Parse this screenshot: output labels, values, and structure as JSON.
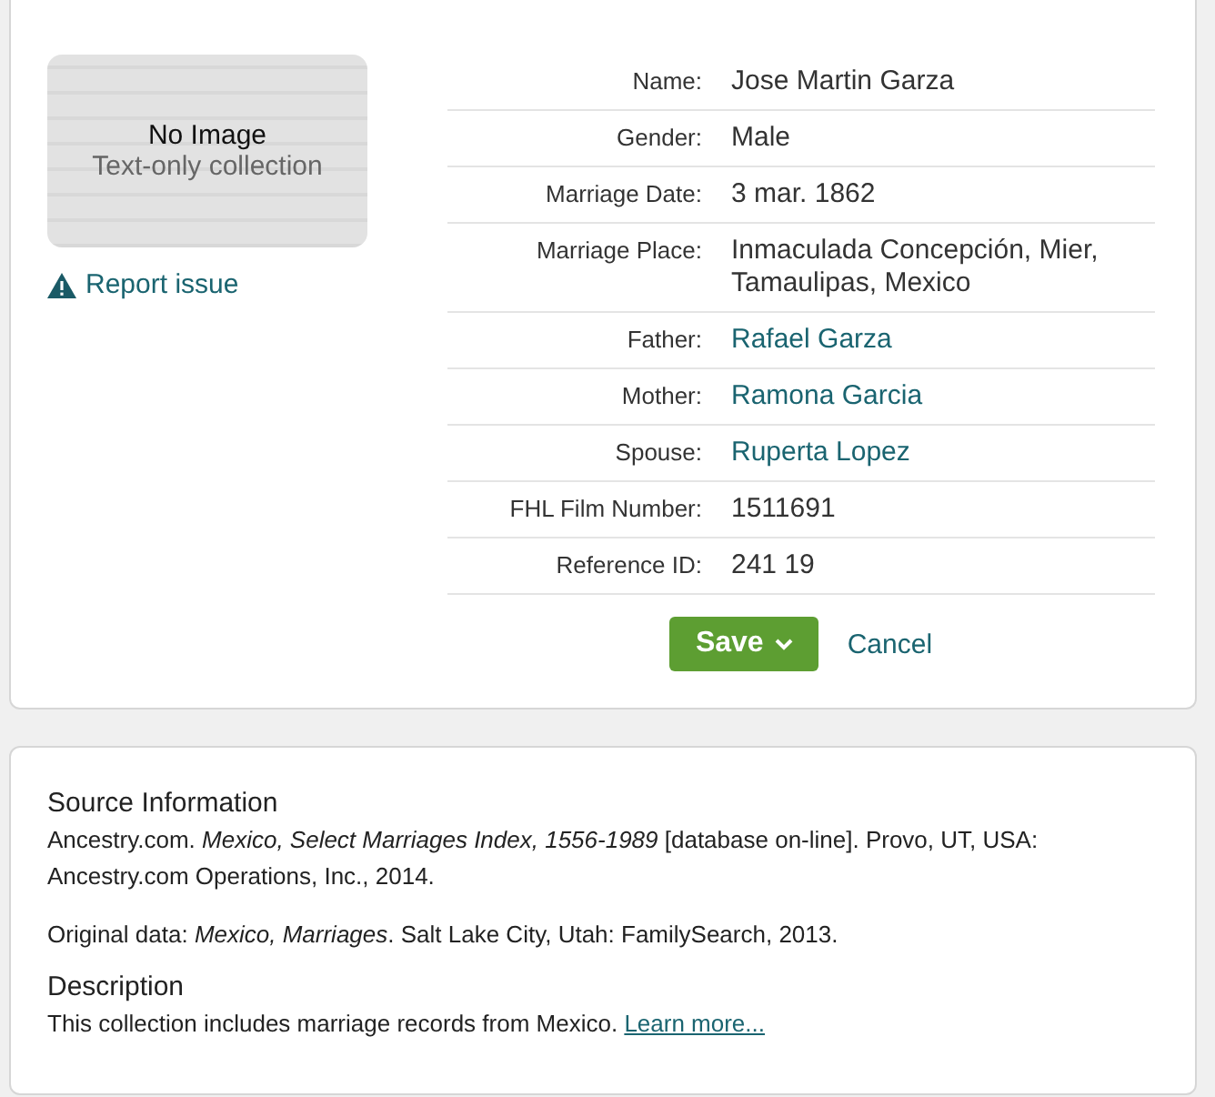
{
  "record": {
    "image": {
      "title": "No Image",
      "subtitle": "Text-only collection"
    },
    "report_link": "Report issue",
    "fields": [
      {
        "label": "Name:",
        "value": "Jose Martin Garza",
        "kind": "text"
      },
      {
        "label": "Gender:",
        "value": "Male",
        "kind": "text"
      },
      {
        "label": "Marriage Date:",
        "value": "3 mar. 1862",
        "kind": "text"
      },
      {
        "label": "Marriage Place:",
        "value": "Inmaculada Concepción, Mier, Tamaulipas, Mexico",
        "kind": "text"
      },
      {
        "label": "Father:",
        "value": "Rafael Garza",
        "kind": "link"
      },
      {
        "label": "Mother:",
        "value": "Ramona Garcia",
        "kind": "link"
      },
      {
        "label": "Spouse:",
        "value": "Ruperta Lopez",
        "kind": "link"
      },
      {
        "label": "FHL Film Number:",
        "value": "1511691",
        "kind": "text"
      },
      {
        "label": "Reference ID:",
        "value": "241 19",
        "kind": "text"
      }
    ],
    "save_button": "Save",
    "cancel_link": "Cancel"
  },
  "source": {
    "heading": "Source Information",
    "paragraphs": [
      "Ancestry.com. *Mexico, Select Marriages Index, 1556-1989* [database on-line]. Provo, UT, USA: Ancestry.com Operations, Inc., 2014.",
      "Original data: *Mexico, Marriages*. Salt Lake City, Utah: FamilySearch, 2013."
    ],
    "description_heading": "Description",
    "description": {
      "text": "This collection includes marriage records from Mexico.",
      "link": "Learn more..."
    }
  }
}
